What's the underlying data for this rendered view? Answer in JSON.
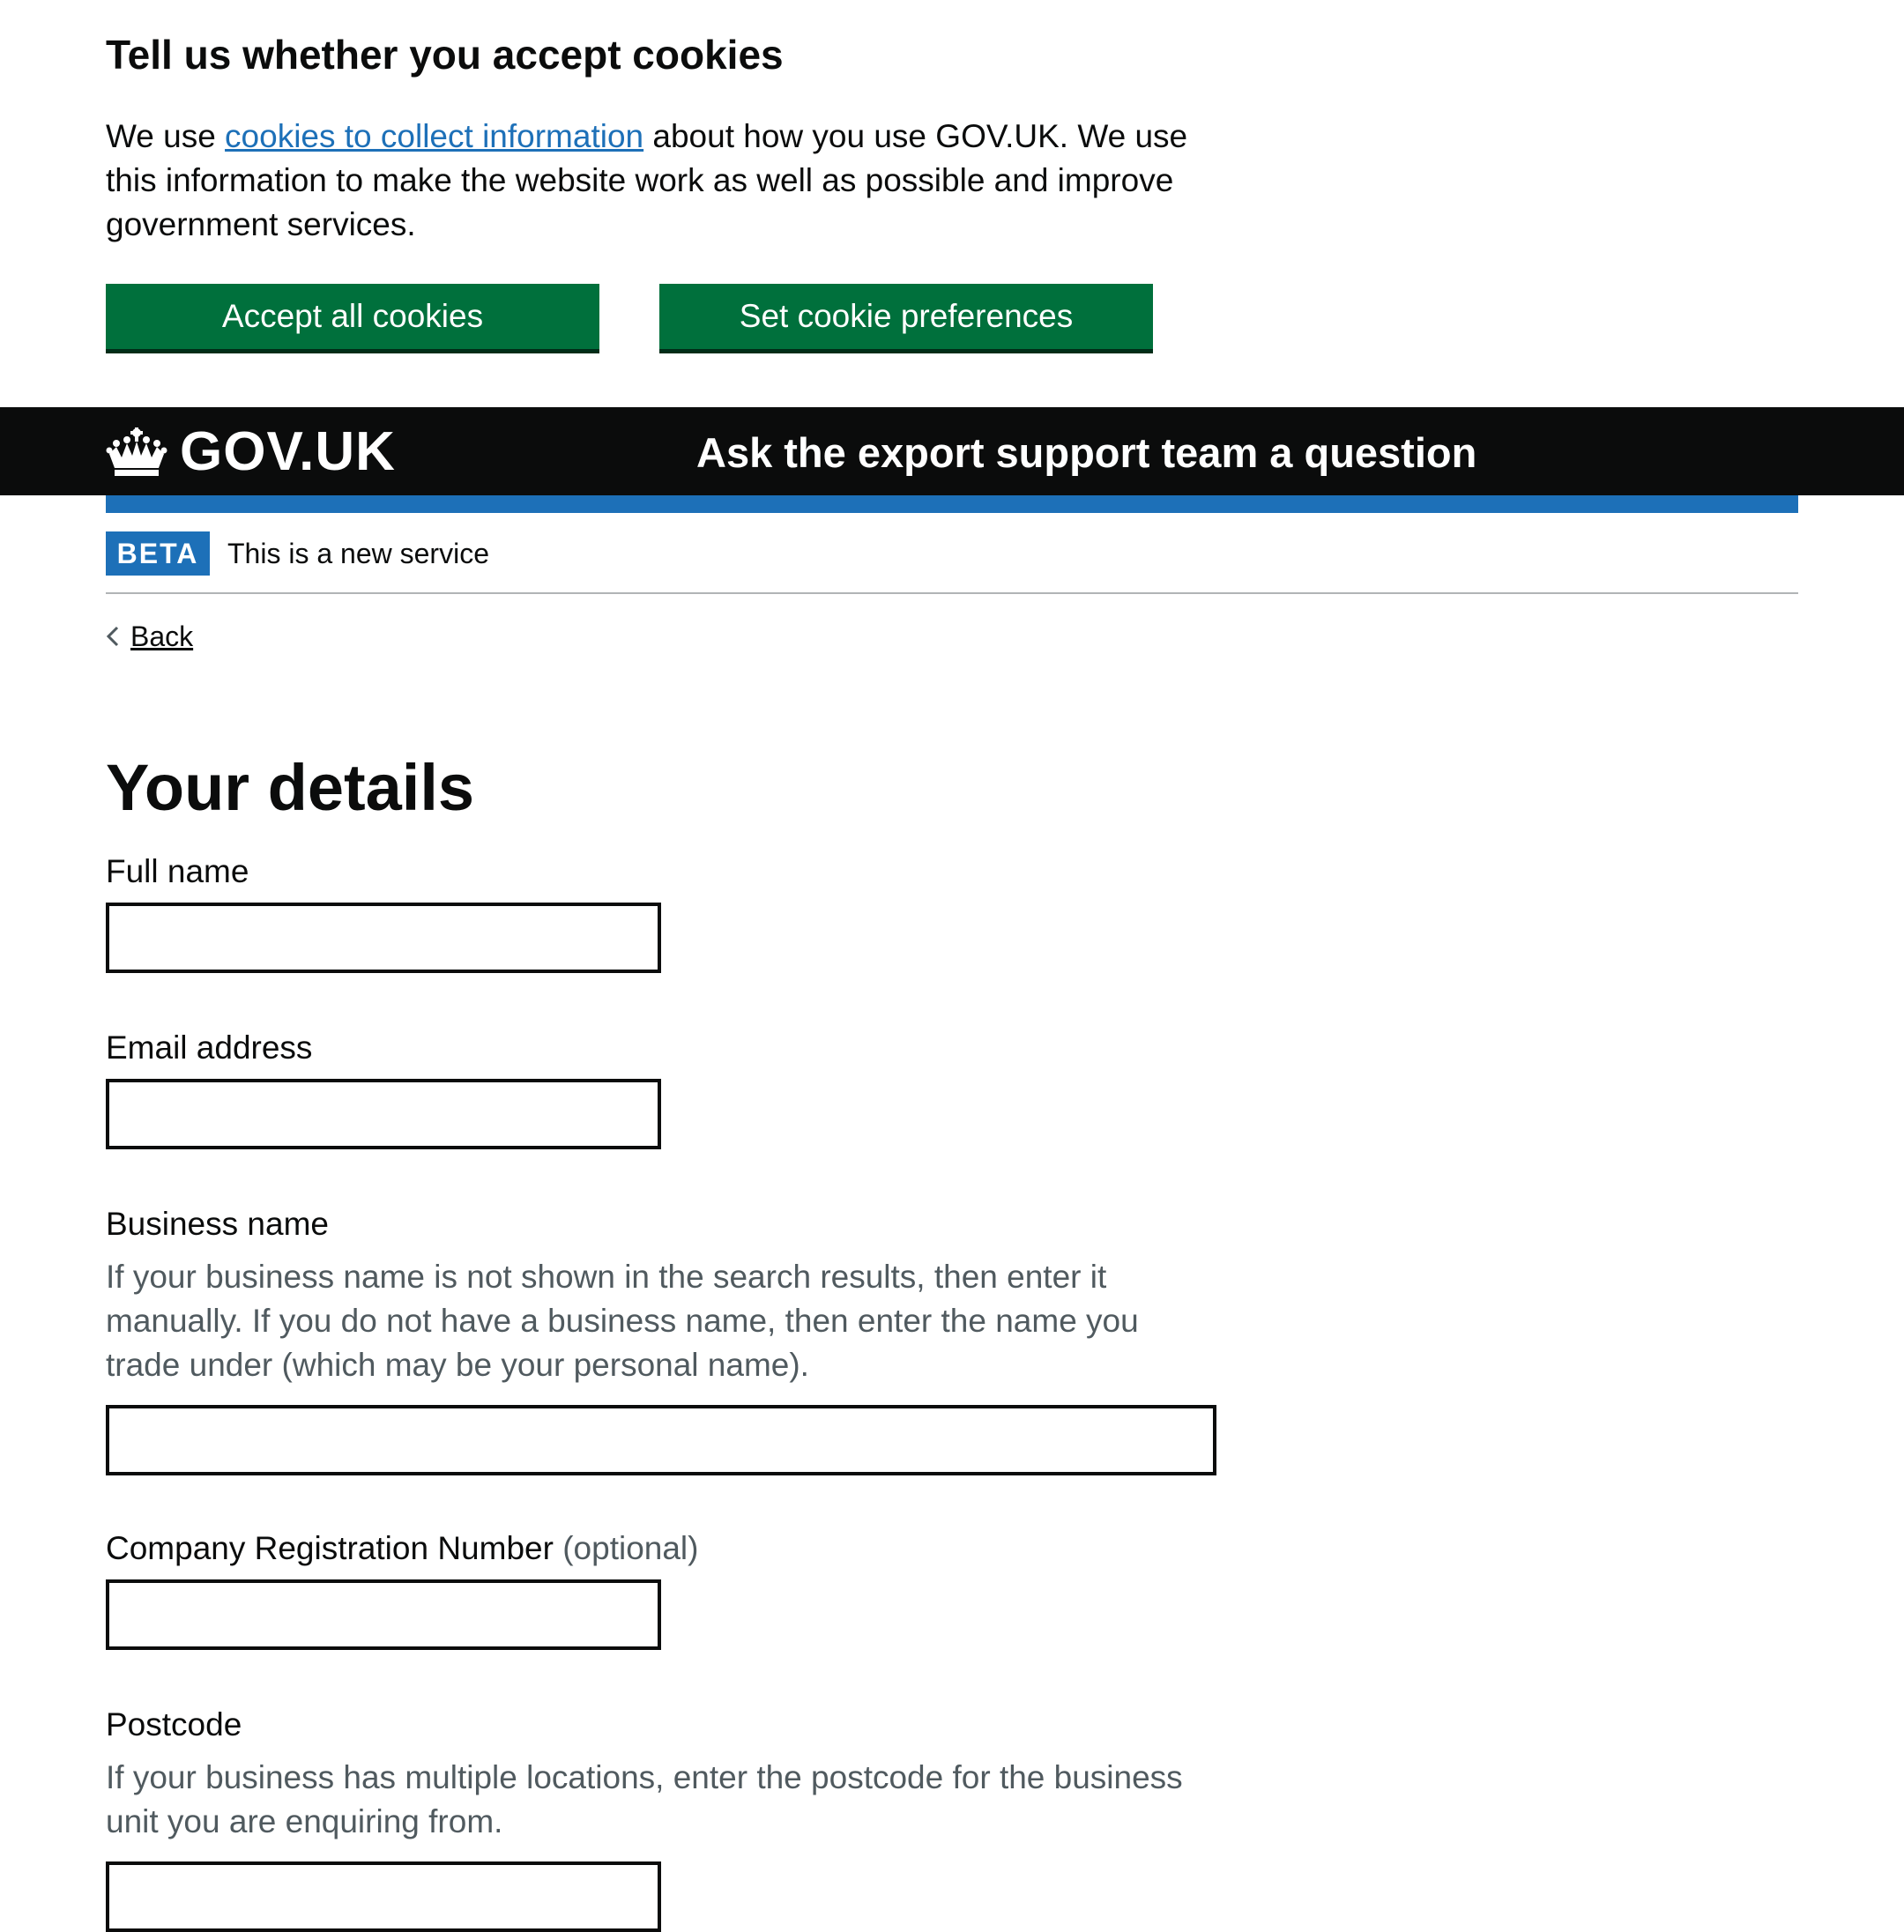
{
  "cookie_banner": {
    "title": "Tell us whether you accept cookies",
    "text_before_link": "We use ",
    "link_text": "cookies to collect information",
    "text_after_link": " about how you use GOV.UK. We use this information to make the website work as well as possible and improve government services.",
    "accept_button": "Accept all cookies",
    "preferences_button": "Set cookie preferences"
  },
  "header": {
    "logo_text": "GOV.UK",
    "logo_icon": "crown-icon",
    "service_name": "Ask the export support team a question"
  },
  "phase_banner": {
    "tag": "BETA",
    "text": "This is a new service"
  },
  "back_link": {
    "label": "Back",
    "icon": "chevron-left-icon"
  },
  "form": {
    "title": "Your details",
    "full_name": {
      "label": "Full name",
      "value": ""
    },
    "email": {
      "label": "Email address",
      "value": ""
    },
    "business_name": {
      "label": "Business name",
      "hint": "If your business name is not shown in the search results, then enter it manually. If you do not have a business name, then enter the name you trade under (which may be your personal name).",
      "value": ""
    },
    "company_reg": {
      "label": "Company Registration Number",
      "optional": "(optional)",
      "value": ""
    },
    "postcode": {
      "label": "Postcode",
      "hint": "If your business has multiple locations, enter the postcode for the business unit you are enquiring from.",
      "value": ""
    }
  },
  "colors": {
    "button_green": "#00703c",
    "link_blue": "#1d70b8",
    "header_black": "#0b0c0c",
    "hint_grey": "#505a5f"
  }
}
